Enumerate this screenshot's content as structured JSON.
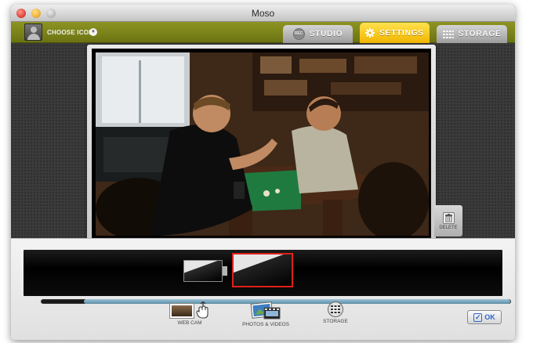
{
  "window": {
    "title": "Moso"
  },
  "topbar": {
    "choose_icon_label": "CHOOSE ICON",
    "tabs": [
      {
        "label": "STUDIO",
        "badge": "REC",
        "icon": "rec-icon",
        "active": false
      },
      {
        "label": "SETTINGS",
        "icon": "gear-icon",
        "active": true
      },
      {
        "label": "STORAGE",
        "icon": "storage-grid-icon",
        "active": false
      }
    ]
  },
  "preview": {
    "delete_label": "DELETE"
  },
  "timeline": {
    "scroll_position": 0.09
  },
  "sources": [
    {
      "label": "WEB CAM",
      "icon": "webcam-icon"
    },
    {
      "label": "PHOTOS & VIDEOS",
      "icon": "photos-videos-icon"
    },
    {
      "label": "STORAGE",
      "icon": "storage-disc-icon"
    }
  ],
  "ok_label": "OK",
  "colors": {
    "topbar": "#7a8119",
    "settings_tab": "#f7c400",
    "selection_border": "#e0201a",
    "ok_accent": "#2d66c9"
  }
}
